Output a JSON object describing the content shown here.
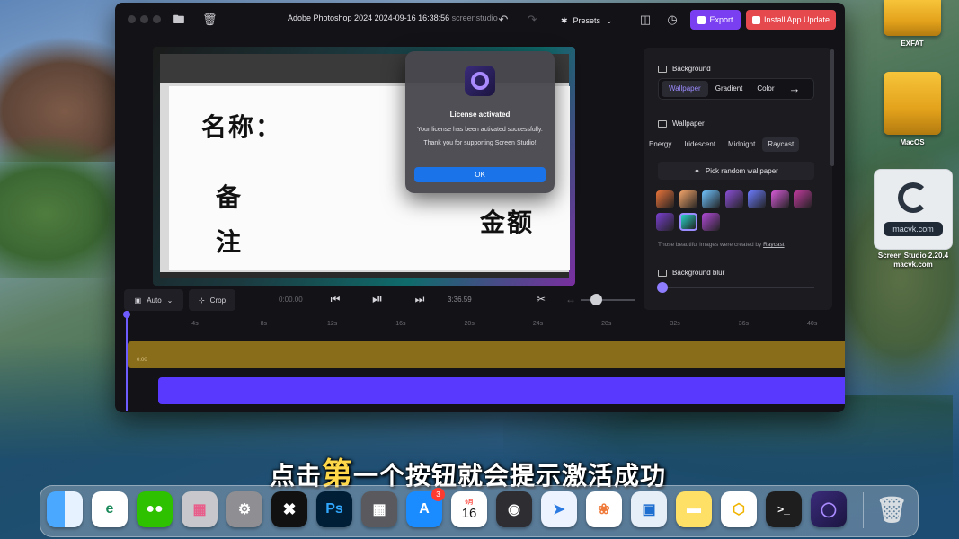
{
  "window": {
    "title": "Adobe Photoshop 2024 2024-09-16 16:38:56",
    "title_suffix": "screenstudio",
    "presets_label": "Presets",
    "export_label": "Export",
    "update_label": "Install App Update"
  },
  "canvas": {
    "cjk_name": "名称：",
    "cjk_note1": "备",
    "cjk_note2": "注",
    "cjk_amount": "金额"
  },
  "dialog": {
    "title": "License activated",
    "message": "Your license has been activated successfully.",
    "thanks": "Thank you for supporting Screen Studio!",
    "ok_label": "OK"
  },
  "panel": {
    "background_title": "Background",
    "tabs": [
      "Wallpaper",
      "Gradient",
      "Color"
    ],
    "wallpaper_title": "Wallpaper",
    "wallpaper_chips": [
      "Energy",
      "Iridescent",
      "Midnight",
      "Raycast"
    ],
    "selected_chip": "Raycast",
    "pick_label": "Pick random wallpaper",
    "credit_text": "Those beautiful images were created by",
    "credit_link": "Raycast",
    "blur_title": "Background blur",
    "swatch_colors": [
      "#e8733a",
      "#f3a46a",
      "#6fc3ff",
      "#8a4fd6",
      "#6c7cff",
      "#d65ad6",
      "#c23a9e",
      "#7a3fd0",
      "#2ad3c8",
      "#b04ad8"
    ]
  },
  "toolbar": {
    "auto_label": "Auto",
    "crop_label": "Crop",
    "time_current": "0:00.00",
    "time_total": "3:36.59"
  },
  "timeline": {
    "ticks": [
      "4s",
      "8s",
      "12s",
      "16s",
      "20s",
      "24s",
      "28s",
      "32s",
      "36s",
      "40s"
    ],
    "clip_label": "0:00"
  },
  "desktop": {
    "drive1": "EXFAT",
    "drive2": "MacOS",
    "sstudio_url": "macvk.com",
    "sstudio_label1": "Screen Studio 2.20.4",
    "sstudio_label2": "macvk.com"
  },
  "subtitle": {
    "pre": "点击",
    "highlight": "第",
    "post": "一个按钮就会提示激活成功"
  },
  "dock": {
    "calendar_month": "9月",
    "calendar_day": "16",
    "appstore_badge": "3",
    "ps_label": "Ps"
  }
}
